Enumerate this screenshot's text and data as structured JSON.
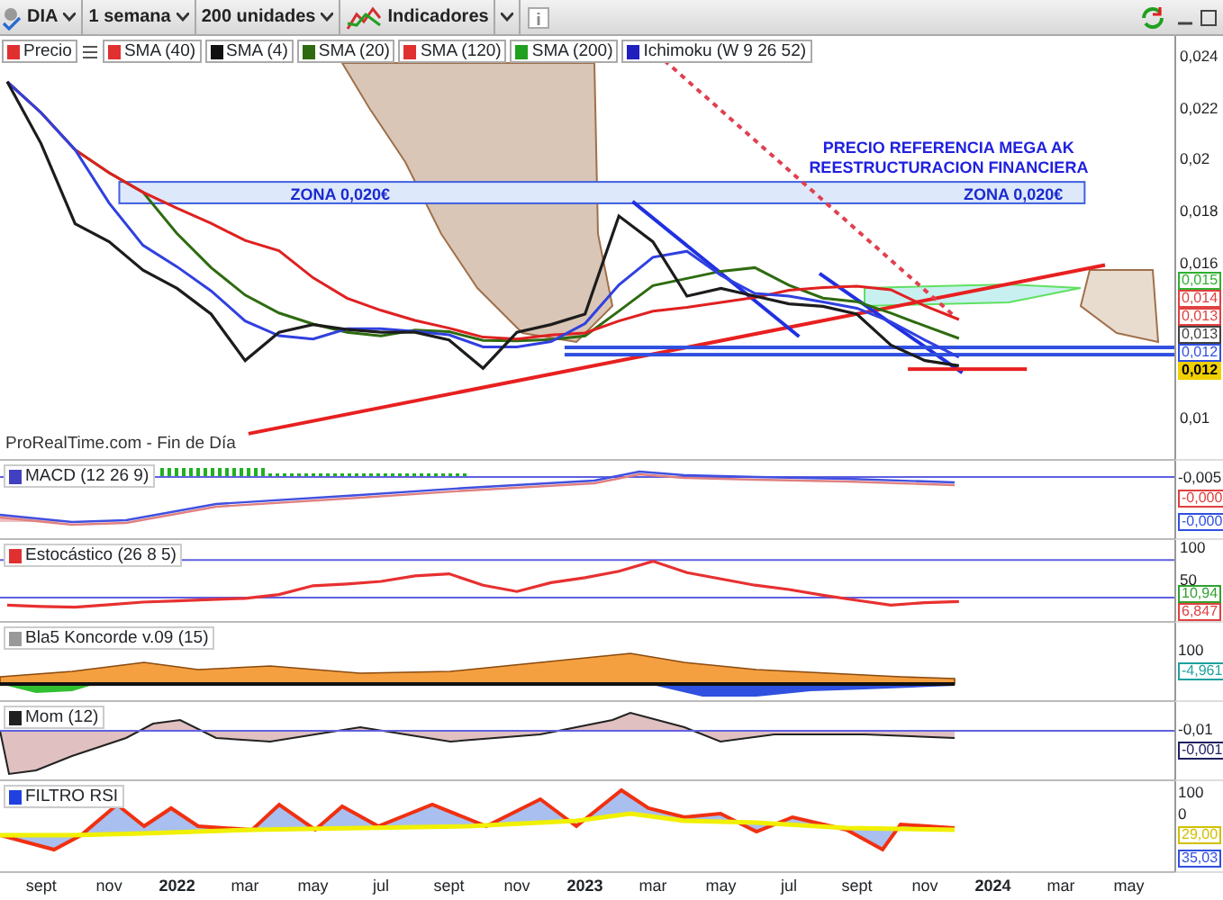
{
  "toolbar": {
    "symbol": "DIA",
    "period": "1 semana",
    "units": "200 unidades",
    "indicators_label": "Indicadores"
  },
  "legend": [
    {
      "label": "Precio",
      "color": "#e03030"
    },
    {
      "label": "SMA (40)",
      "color": "#e03030"
    },
    {
      "label": "SMA (4)",
      "color": "#111111"
    },
    {
      "label": "SMA (20)",
      "color": "#2e6b10"
    },
    {
      "label": "SMA (120)",
      "color": "#e03030"
    },
    {
      "label": "SMA (200)",
      "color": "#20a020"
    },
    {
      "label": "Ichimoku (W 9 26 52)",
      "color": "#2020c0"
    }
  ],
  "main": {
    "source": "ProRealTime.com - Fin de Día",
    "value_tags": [
      {
        "text": "0,015",
        "color": "#30b030",
        "kind": "plain"
      },
      {
        "text": "0,014",
        "color": "#e04040",
        "kind": "plain"
      },
      {
        "text": "0,013",
        "color": "#e04040",
        "kind": "plain"
      },
      {
        "text": "0,013",
        "color": "#404040",
        "kind": "plain"
      },
      {
        "text": "0,012",
        "color": "#3050e0",
        "kind": "plain"
      },
      {
        "text": "0,012",
        "color": "#f0d000",
        "kind": "current"
      }
    ],
    "axis_labels": [
      "0,024",
      "0,022",
      "0,02",
      "0,018",
      "0,016",
      "0,01"
    ],
    "drawings": [
      {
        "kind": "text",
        "text": "PRECIO REFERENCIA MEGA AK REESTRUCTURACION FINANCIERA",
        "color": "#2020e0"
      },
      {
        "kind": "band",
        "color": "#4060e0",
        "labels": [
          "ZONA 0,020€",
          "ZONA 0,020€"
        ]
      },
      {
        "kind": "line",
        "color": "#e82020",
        "dashed": false
      },
      {
        "kind": "line",
        "color": "#2030e0",
        "dashed": false
      },
      {
        "kind": "line",
        "color": "#2030e0",
        "dashed": false
      },
      {
        "kind": "line",
        "color": "#e04050",
        "dashed": true
      },
      {
        "kind": "line",
        "color": "#3050e0",
        "dashed": false
      },
      {
        "kind": "line",
        "color": "#3050e0",
        "dashed": false
      },
      {
        "kind": "line",
        "color": "#e82020",
        "dashed": false
      }
    ]
  },
  "panes": [
    {
      "kind": "macd",
      "title": "MACD (12 26 9)",
      "color": "#4040c0",
      "axis_labels": [
        "-0,005"
      ],
      "value_tags": [
        {
          "text": "-0,000",
          "color": "#e04040"
        },
        {
          "text": "-0,000",
          "color": "#3050e0"
        }
      ]
    },
    {
      "kind": "stochastic",
      "title": "Estocástico (26 8 5)",
      "color": "#e03030",
      "axis_labels": [
        "100",
        "50"
      ],
      "value_tags": [
        {
          "text": "10,94",
          "color": "#30a030"
        },
        {
          "text": "6,847",
          "color": "#e04040"
        }
      ]
    },
    {
      "kind": "koncorde",
      "title": "Bla5 Koncorde v.09 (15)",
      "color": "#999999",
      "axis_labels": [
        "100"
      ],
      "value_tags": [
        {
          "text": "-4,961",
          "color": "#20a0a0"
        }
      ]
    },
    {
      "kind": "momentum",
      "title": "Mom (12)",
      "color": "#202020",
      "axis_labels": [
        "-0,01"
      ],
      "value_tags": [
        {
          "text": "-0,001",
          "color": "#202060"
        }
      ]
    },
    {
      "kind": "rsi",
      "title": "FILTRO RSI",
      "color": "#2040e0",
      "axis_labels": [
        "100",
        "0"
      ],
      "value_tags": [
        {
          "text": "29,00",
          "color": "#d0c000"
        },
        {
          "text": "35,03",
          "color": "#3050e0"
        }
      ]
    }
  ],
  "time_axis": [
    {
      "label": "sept",
      "kind": "month"
    },
    {
      "label": "nov",
      "kind": "month"
    },
    {
      "label": "2022",
      "kind": "year"
    },
    {
      "label": "mar",
      "kind": "month"
    },
    {
      "label": "may",
      "kind": "month"
    },
    {
      "label": "jul",
      "kind": "month"
    },
    {
      "label": "sept",
      "kind": "month"
    },
    {
      "label": "nov",
      "kind": "month"
    },
    {
      "label": "2023",
      "kind": "year"
    },
    {
      "label": "mar",
      "kind": "month"
    },
    {
      "label": "may",
      "kind": "month"
    },
    {
      "label": "jul",
      "kind": "month"
    },
    {
      "label": "sept",
      "kind": "month"
    },
    {
      "label": "nov",
      "kind": "month"
    },
    {
      "label": "2024",
      "kind": "year"
    },
    {
      "label": "mar",
      "kind": "month"
    },
    {
      "label": "may",
      "kind": "month"
    }
  ]
}
